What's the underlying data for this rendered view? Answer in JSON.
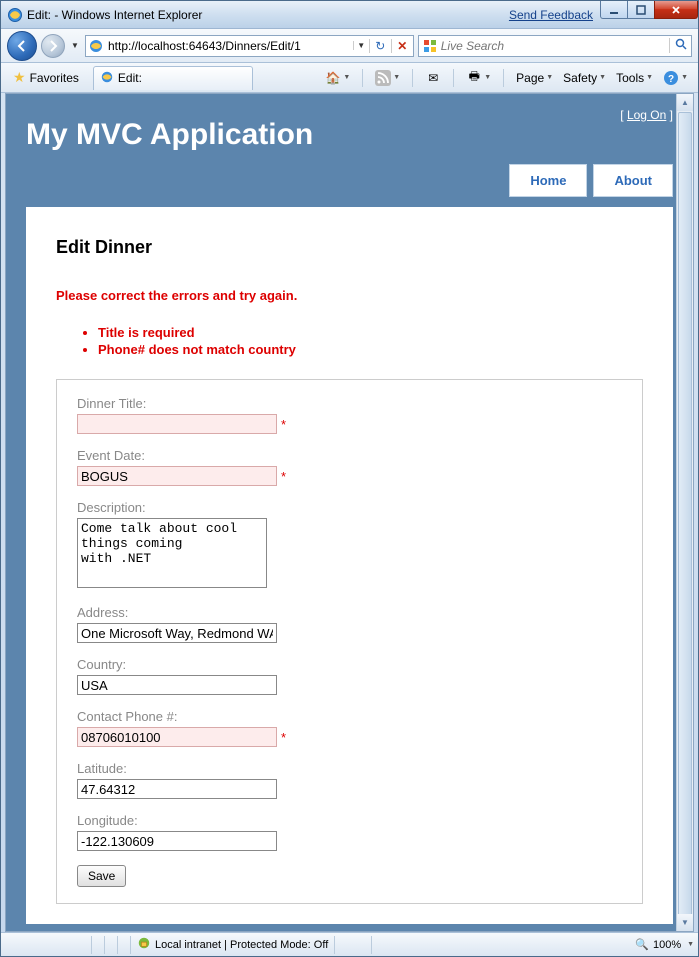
{
  "window": {
    "title": "Edit: - Windows Internet Explorer",
    "feedback": "Send Feedback"
  },
  "nav": {
    "url": "http://localhost:64643/Dinners/Edit/1",
    "search_placeholder": "Live Search"
  },
  "cmdbar": {
    "favorites": "Favorites",
    "tab_title": "Edit:",
    "page": "Page",
    "safety": "Safety",
    "tools": "Tools"
  },
  "app": {
    "title": "My MVC Application",
    "logon": "Log On",
    "menu": {
      "home": "Home",
      "about": "About"
    }
  },
  "content": {
    "heading": "Edit Dinner",
    "validation_summary": "Please correct the errors and try again.",
    "errors": {
      "e0": "Title is required",
      "e1": "Phone# does not match country"
    },
    "labels": {
      "title": "Dinner Title:",
      "eventdate": "Event Date:",
      "description": "Description:",
      "address": "Address:",
      "country": "Country:",
      "phone": "Contact Phone #:",
      "latitude": "Latitude:",
      "longitude": "Longitude:"
    },
    "values": {
      "title": "",
      "eventdate": "BOGUS",
      "description": "Come talk about cool things coming\nwith .NET",
      "address": "One Microsoft Way, Redmond WA",
      "country": "USA",
      "phone": "08706010100",
      "latitude": "47.64312",
      "longitude": "-122.130609"
    },
    "req_marker": "*",
    "save": "Save"
  },
  "status": {
    "zone": "Local intranet | Protected Mode: Off",
    "zoom": "100%"
  }
}
